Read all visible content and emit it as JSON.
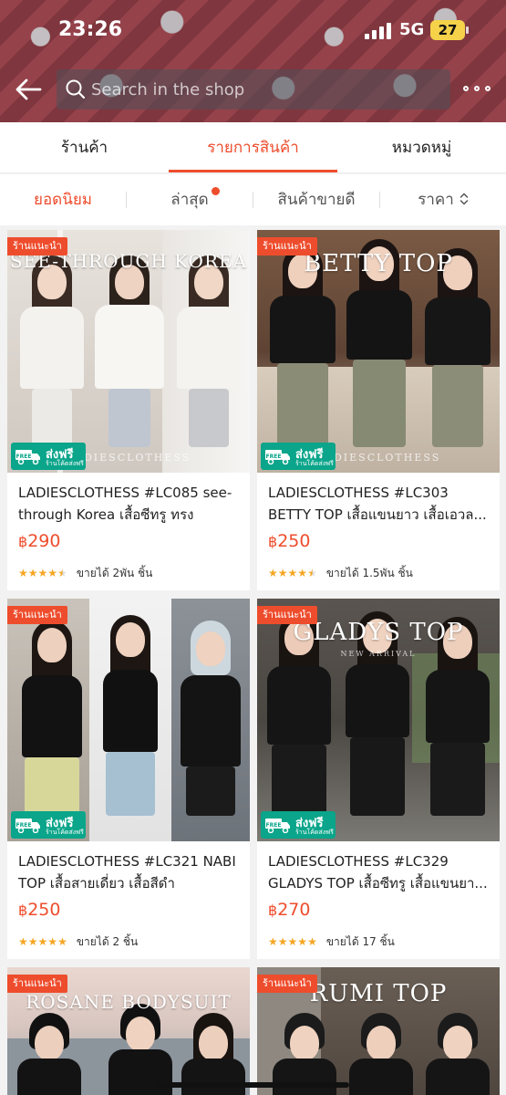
{
  "status_bar": {
    "time": "23:26",
    "network": "5G",
    "battery": "27"
  },
  "search": {
    "placeholder": "Search in the shop"
  },
  "tabs": [
    {
      "label": "ร้านค้า",
      "active": false
    },
    {
      "label": "รายการสินค้า",
      "active": true
    },
    {
      "label": "หมวดหมู่",
      "active": false
    }
  ],
  "sort": [
    {
      "label": "ยอดนิยม",
      "active": true
    },
    {
      "label": "ล่าสุด",
      "active": false
    },
    {
      "label": "สินค้าขายดี",
      "active": false
    },
    {
      "label": "ราคา",
      "active": false
    }
  ],
  "products": [
    {
      "badge": "ร้านแนะนำ",
      "overlay_title": "SEE-THROUGH KOREA",
      "watermark": "LADIESCLOTHESS",
      "name": "LADIESCLOTHESS #LC085 see-through Korea เสื้อซีทรู ทรง Over...",
      "price_currency": "฿",
      "price": "290",
      "rating": 4.5,
      "sold": "ขายได้ 2พัน ชิ้น",
      "free_shipping": "ส่งฟรี",
      "free_shipping_sub": "ร้านโค้ดส่งฟรี"
    },
    {
      "badge": "ร้านแนะนำ",
      "overlay_title": "BETTY TOP",
      "watermark": "LADIESCLOTHESS",
      "name": "LADIESCLOTHESS #LC303 BETTY TOP เสื้อแขนยาว เสื้อเอวล...",
      "price_currency": "฿",
      "price": "250",
      "rating": 4.5,
      "sold": "ขายได้ 1.5พัน ชิ้น",
      "free_shipping": "ส่งฟรี",
      "free_shipping_sub": "ร้านโค้ดส่งฟรี"
    },
    {
      "badge": "ร้านแนะนำ",
      "overlay_title": "",
      "watermark": "",
      "name": "LADIESCLOTHESS #LC321 NABI TOP เสื้อสายเดี่ยว เสื้อสีดำ",
      "price_currency": "฿",
      "price": "250",
      "rating": 5,
      "sold": "ขายได้ 2 ชิ้น",
      "free_shipping": "ส่งฟรี",
      "free_shipping_sub": "ร้านโค้ดส่งฟรี"
    },
    {
      "badge": "ร้านแนะนำ",
      "overlay_title": "GLADYS TOP",
      "watermark": "NEW ARRIVAL",
      "name": "LADIESCLOTHESS #LC329 GLADYS TOP เสื้อซีทรู เสื้อแขนยา...",
      "price_currency": "฿",
      "price": "270",
      "rating": 5,
      "sold": "ขายได้ 17 ชิ้น",
      "free_shipping": "ส่งฟรี",
      "free_shipping_sub": "ร้านโค้ดส่งฟรี"
    },
    {
      "badge": "ร้านแนะนำ",
      "overlay_title": "ROSANE BODYSUIT"
    },
    {
      "badge": "ร้านแนะนำ",
      "overlay_title": "RUMI TOP"
    }
  ],
  "colors": {
    "accent": "#ee4d2d",
    "free_shipping": "#0aa58a",
    "star": "#f5a623"
  },
  "icons": [
    "back-arrow-icon",
    "search-icon",
    "more-icon",
    "chevron-updown-icon",
    "truck-icon",
    "star-icon"
  ]
}
